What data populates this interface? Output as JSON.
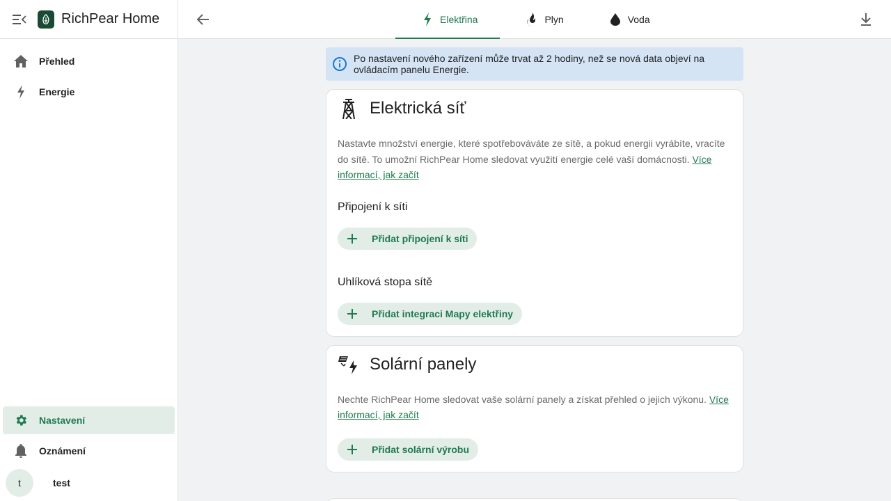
{
  "app": {
    "title": "RichPear Home"
  },
  "sidebar": {
    "items": [
      {
        "label": "Přehled",
        "icon": "home-icon"
      },
      {
        "label": "Energie",
        "icon": "lightning-icon"
      }
    ],
    "bottom": [
      {
        "label": "Nastavení",
        "icon": "gear-icon",
        "active": true
      },
      {
        "label": "Oznámení",
        "icon": "bell-icon"
      }
    ],
    "user": {
      "initial": "t",
      "name": "test"
    }
  },
  "tabs": [
    {
      "label": "Elektřina",
      "icon": "lightning-icon",
      "active": true
    },
    {
      "label": "Plyn",
      "icon": "flame-icon"
    },
    {
      "label": "Voda",
      "icon": "water-drop-icon"
    }
  ],
  "alert": {
    "text": "Po nastavení nového zařízení může trvat až 2 hodiny, než se nová data objeví na ovládacím panelu Energie."
  },
  "grid_card": {
    "title": "Elektrická síť",
    "description": "Nastavte množství energie, které spotřebováváte ze sítě, a pokud energii vyrábíte, vracíte do sítě. To umožní RichPear Home sledovat využití energie celé vaší domácnosti.",
    "link": "Více informací, jak začít",
    "section1": "Připojení k síti",
    "button1": "Přidat připojení k síti",
    "section2": "Uhlíková stopa sítě",
    "button2": "Přidat integraci Mapy elektřiny"
  },
  "solar_card": {
    "title": "Solární panely",
    "description": "Nechte RichPear Home sledovat vaše solární panely a získat přehled o jejich výkonu.",
    "link": "Více informací, jak začít",
    "button": "Přidat solární výrobu"
  },
  "colors": {
    "accent": "#1f7a50",
    "pill_bg": "#e3ede8",
    "alert_bg": "#d5e4f5"
  }
}
